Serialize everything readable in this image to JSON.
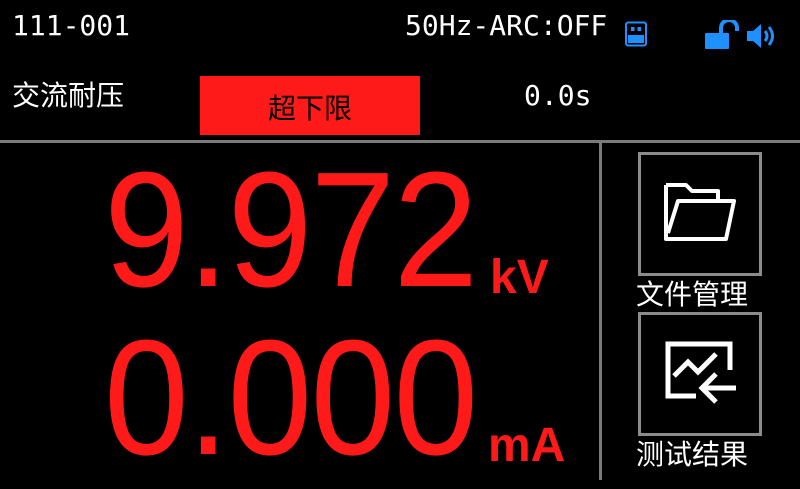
{
  "status_bar": {
    "file_id": "111-001",
    "freq_arc": "50Hz-ARC:OFF",
    "icons": [
      "usb-icon",
      "unlock-icon",
      "speaker-icon"
    ],
    "icon_color": "#1e90ff"
  },
  "test": {
    "mode": "交流耐压",
    "status": "超下限",
    "timer": "0.0s",
    "status_color": "#ff1a1a"
  },
  "readings": {
    "voltage": {
      "value": "9.972",
      "unit": "kV"
    },
    "current": {
      "value": "0.000",
      "unit": "mA"
    },
    "color": "#ff1a1a"
  },
  "side_menu": {
    "file_management": "文件管理",
    "test_results": "测试结果",
    "icons": [
      "folder-icon",
      "test-result-icon"
    ]
  }
}
